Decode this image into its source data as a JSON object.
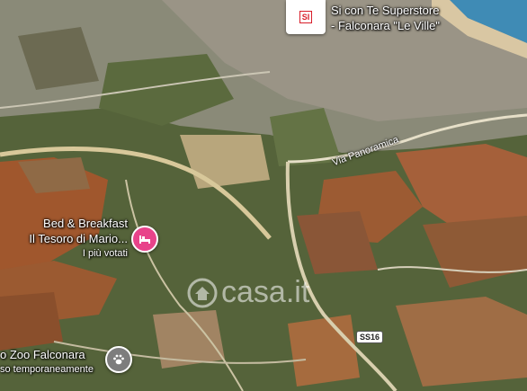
{
  "places": {
    "store": {
      "name_line1": "Si con Te Superstore",
      "name_line2": "- Falconara \"Le Ville\"",
      "logo_text": "SI"
    },
    "bnb": {
      "name_line1": "Bed & Breakfast",
      "name_line2": "Il Tesoro di Mario...",
      "subtitle": "I più votati",
      "icon": "bed-icon",
      "pin_color": "#e8438a"
    },
    "zoo": {
      "name_line1": "o Zoo Falconara",
      "subtitle": "so temporaneamente",
      "icon": "paw-icon",
      "pin_color": "#7d7d7d"
    }
  },
  "roads": {
    "via_panoramica": "Via Panoramica",
    "ss16": "SS16"
  },
  "watermark": "casa.it",
  "colors": {
    "sea": "#3f8bb5",
    "field_orange": "#a0572d",
    "vegetation": "#4a5a2f"
  }
}
